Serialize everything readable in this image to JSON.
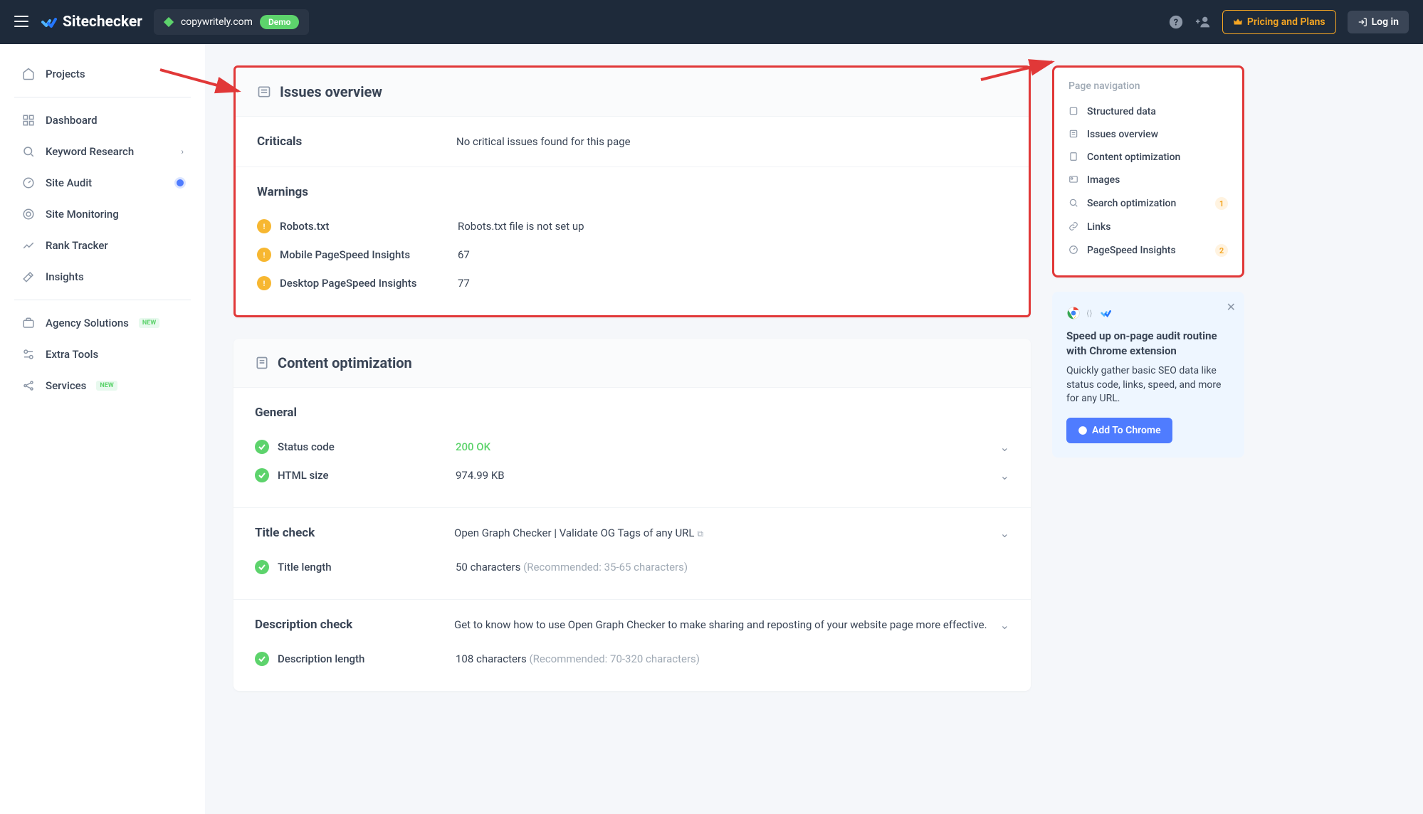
{
  "header": {
    "brand": "Sitechecker",
    "site": "copywritely.com",
    "demo": "Demo",
    "pricing": "Pricing and Plans",
    "login": "Log in"
  },
  "sidebar": {
    "projects": "Projects",
    "dashboard": "Dashboard",
    "keyword": "Keyword Research",
    "audit": "Site Audit",
    "monitoring": "Site Monitoring",
    "rank": "Rank Tracker",
    "insights": "Insights",
    "agency": "Agency Solutions",
    "extra": "Extra Tools",
    "services": "Services",
    "new_badge": "NEW"
  },
  "issues": {
    "title": "Issues overview",
    "criticals_label": "Criticals",
    "criticals_msg": "No critical issues found for this page",
    "warnings_label": "Warnings",
    "rows": [
      {
        "label": "Robots.txt",
        "value": "Robots.txt file is not set up"
      },
      {
        "label": "Mobile PageSpeed Insights",
        "value": "67"
      },
      {
        "label": "Desktop PageSpeed Insights",
        "value": "77"
      }
    ]
  },
  "content": {
    "title": "Content optimization",
    "general_label": "General",
    "status_label": "Status code",
    "status_value": "200 OK",
    "html_label": "HTML size",
    "html_value": "974.99 KB",
    "title_check_label": "Title check",
    "title_check_value": "Open Graph Checker | Validate OG Tags of any URL",
    "title_len_label": "Title length",
    "title_len_value": "50 characters ",
    "title_len_rec": "(Recommended: 35-65 characters)",
    "desc_check_label": "Description check",
    "desc_check_value": "Get to know how to use Open Graph Checker to make sharing and reposting of your website page more effective.",
    "desc_len_label": "Description length",
    "desc_len_value": "108 characters ",
    "desc_len_rec": "(Recommended: 70-320 characters)"
  },
  "nav": {
    "title": "Page navigation",
    "items": [
      {
        "label": "Structured data"
      },
      {
        "label": "Issues overview"
      },
      {
        "label": "Content optimization"
      },
      {
        "label": "Images"
      },
      {
        "label": "Search optimization",
        "badge": "1"
      },
      {
        "label": "Links"
      },
      {
        "label": "PageSpeed Insights",
        "badge": "2"
      }
    ]
  },
  "promo": {
    "title": "Speed up on-page audit routine with Chrome extension",
    "text": "Quickly gather basic SEO data like status code, links, speed, and more for any URL.",
    "cta": "Add To Chrome"
  }
}
